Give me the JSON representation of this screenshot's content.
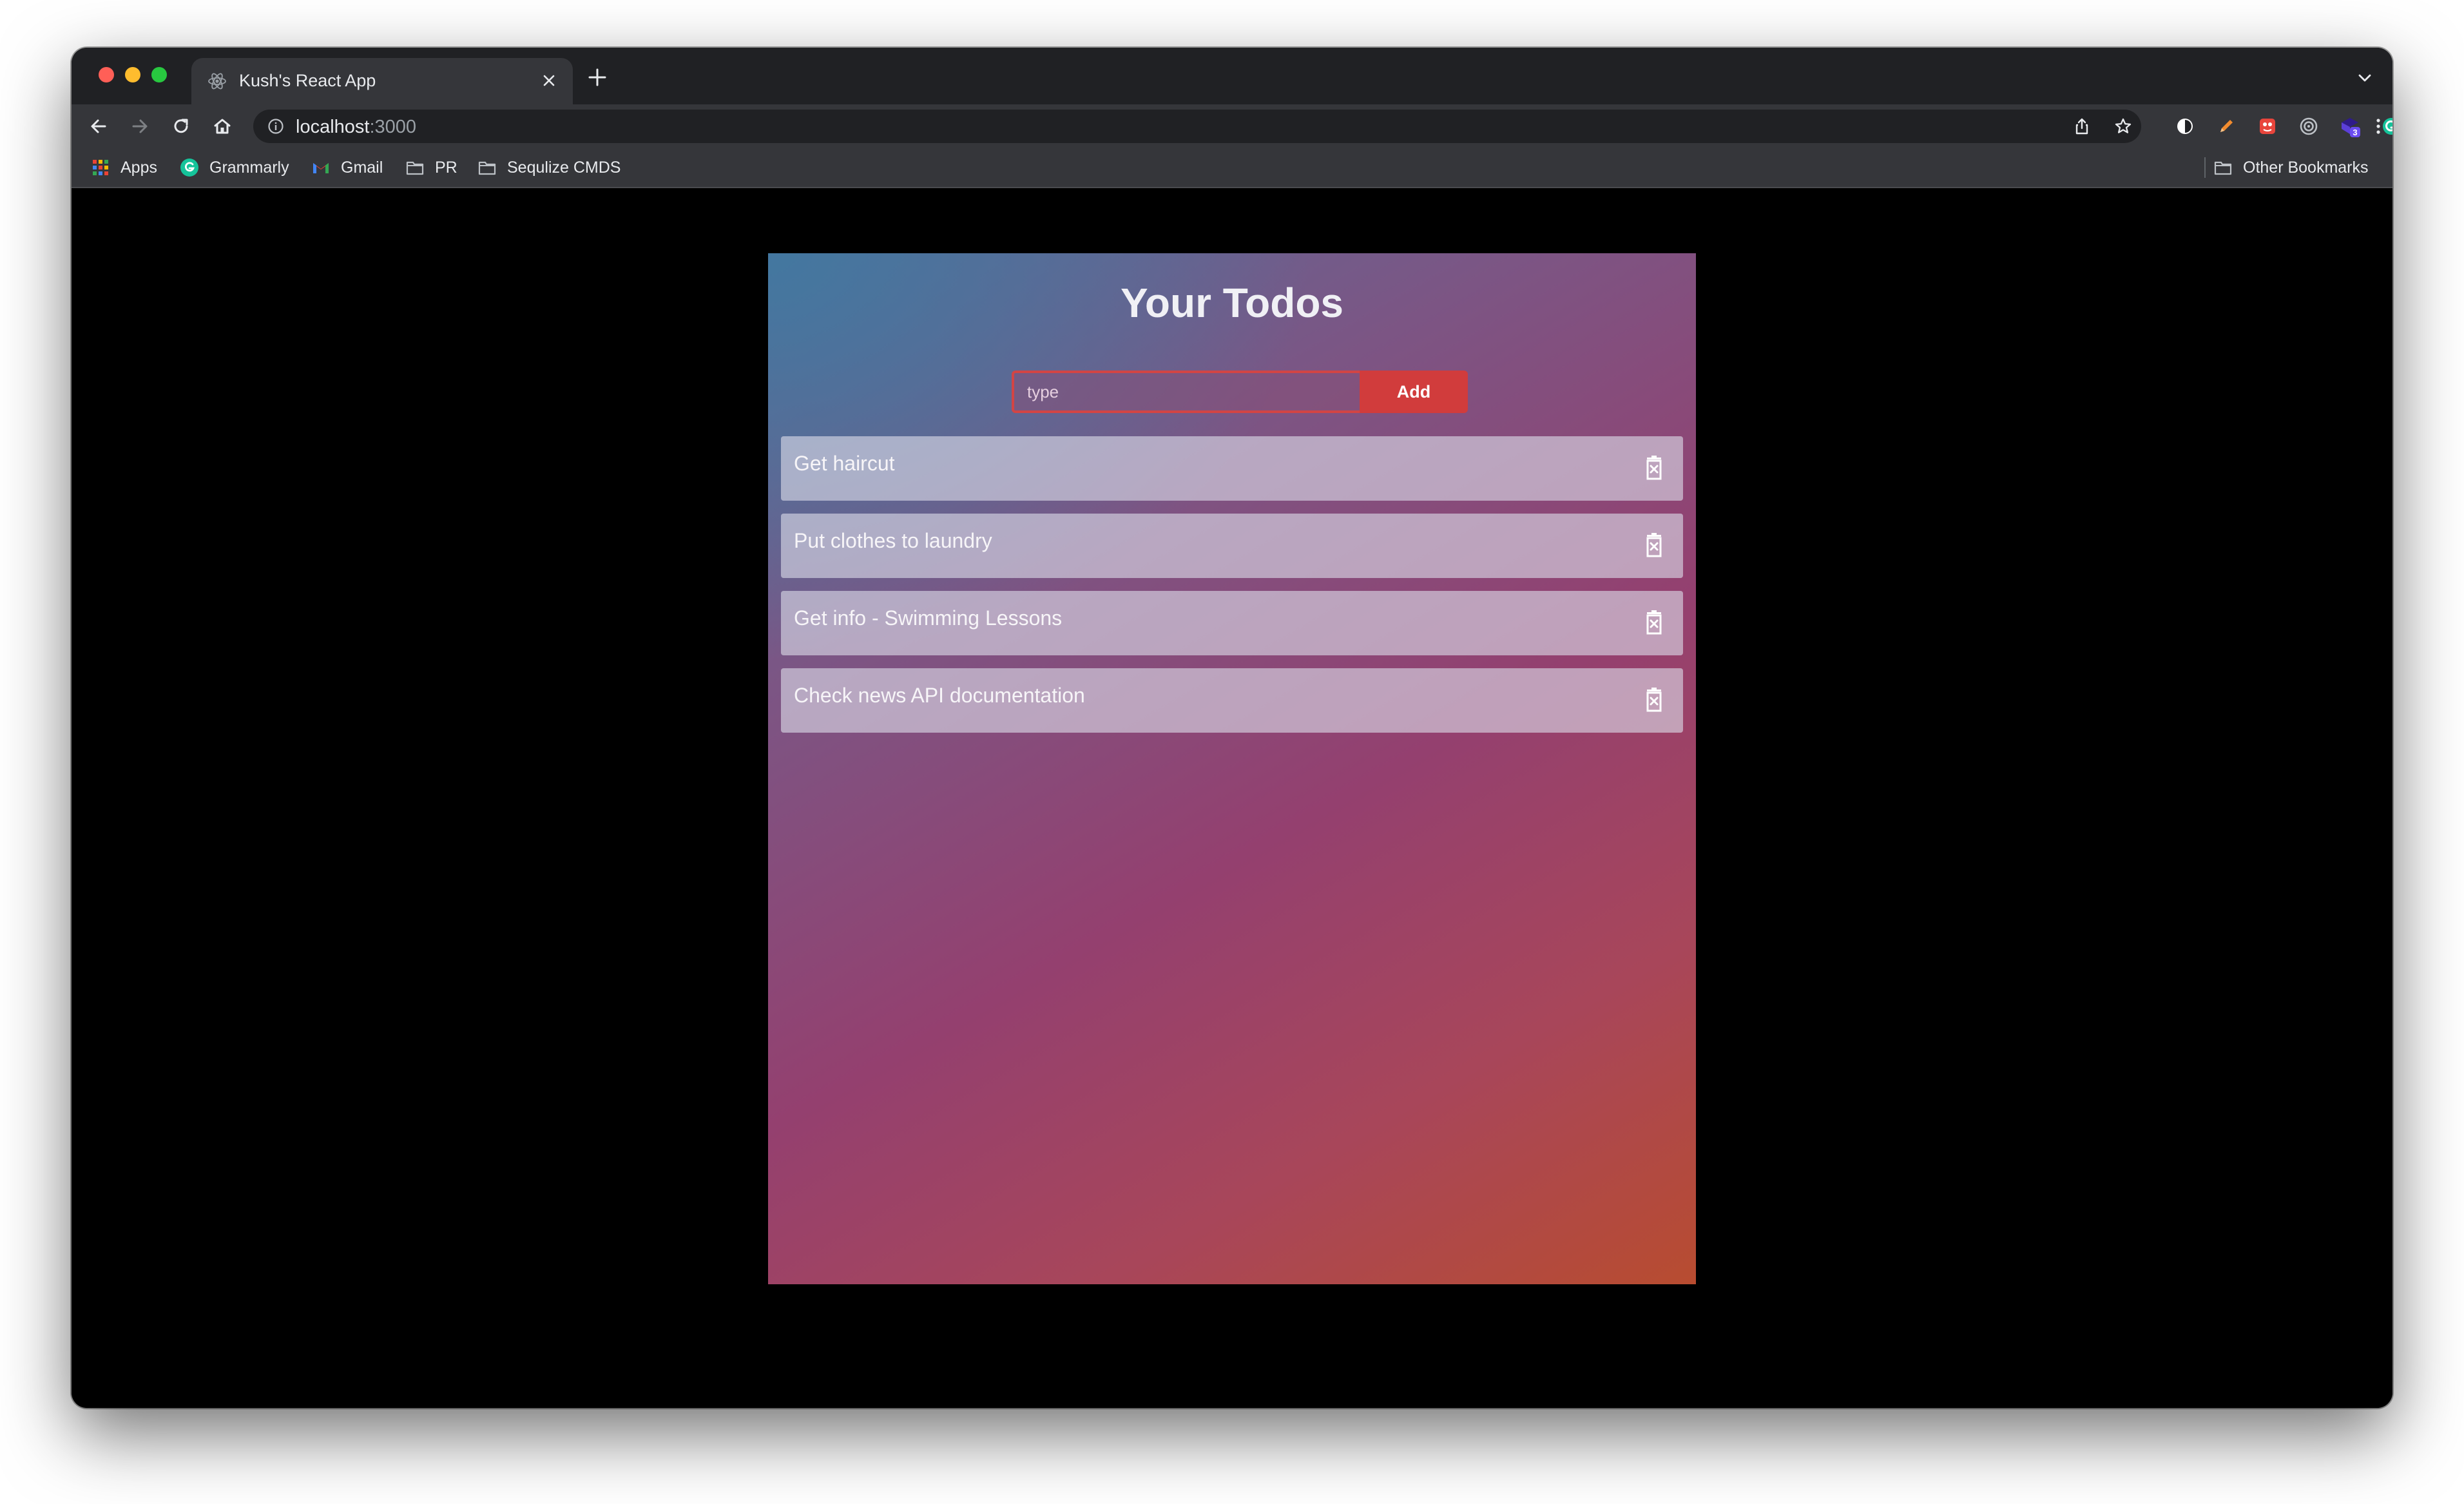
{
  "browser": {
    "tab": {
      "title": "Kush's React App",
      "favicon": "react-atom-icon",
      "close_icon": "close-icon"
    },
    "new_tab_icon": "plus-icon",
    "tab_search_icon": "chevron-down-icon",
    "nav": {
      "back_icon": "back-arrow-icon",
      "forward_icon": "forward-arrow-icon",
      "reload_icon": "reload-icon",
      "home_icon": "home-icon"
    },
    "address_bar": {
      "host": "localhost",
      "port": ":3000",
      "info_icon": "info-icon",
      "share_icon": "share-icon",
      "star_icon": "star-icon"
    },
    "extensions": [
      {
        "name": "circle-extension-icon",
        "color": "#ffffff"
      },
      {
        "name": "pen-extension-icon",
        "color": "#f28b2e"
      },
      {
        "name": "red-square-extension-icon",
        "color": "#e8453c"
      },
      {
        "name": "target-extension-icon",
        "color": "#bdc1c6"
      },
      {
        "name": "purple-extension-icon",
        "color": "#5b3fd8",
        "badge": "3"
      },
      {
        "name": "grammarly-extension-icon",
        "color": "#15c39a"
      },
      {
        "name": "puzzle-icon",
        "color": "#e8eaed"
      },
      {
        "name": "sidebar-icon",
        "color": "#e8eaed"
      },
      {
        "name": "profile-avatar",
        "color": "#9aa0a6"
      },
      {
        "name": "kebab-menu-icon",
        "color": "#e8eaed"
      }
    ],
    "bookmarks": [
      {
        "label": "Apps",
        "icon": "apps-grid-icon"
      },
      {
        "label": "Grammarly",
        "icon": "grammarly-icon"
      },
      {
        "label": "Gmail",
        "icon": "gmail-icon"
      },
      {
        "label": "PR",
        "icon": "folder-icon"
      },
      {
        "label": "Sequlize CMDS",
        "icon": "folder-icon"
      }
    ],
    "other_bookmarks": {
      "label": "Other Bookmarks",
      "icon": "folder-icon"
    }
  },
  "app": {
    "title": "Your Todos",
    "input": {
      "placeholder": "type",
      "value": ""
    },
    "add_label": "Add",
    "todos": [
      {
        "text": "Get haircut"
      },
      {
        "text": "Put clothes to laundry"
      },
      {
        "text": "Get info - Swimming Lessons"
      },
      {
        "text": "Check news API documentation"
      }
    ],
    "colors": {
      "accent": "#d13c3c",
      "gradient_start": "#4a7aa0",
      "gradient_mid": "#94406f",
      "gradient_end": "#b84c30"
    }
  }
}
